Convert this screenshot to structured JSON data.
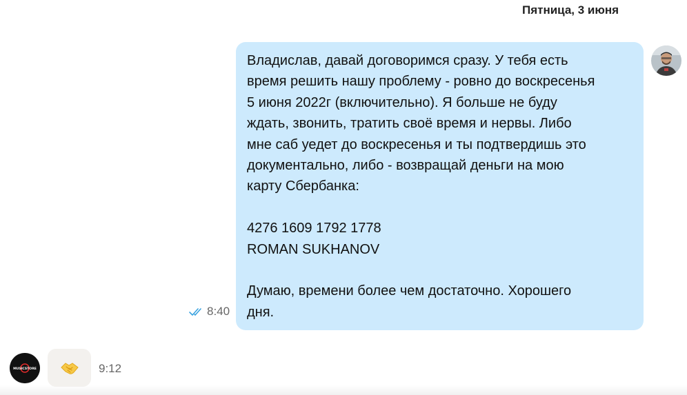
{
  "date_header": "Пятница, 3 июня",
  "messages": [
    {
      "direction": "outgoing",
      "text": "Владислав, давай договоримся сразу. У тебя есть\nвремя решить нашу проблему - ровно до воскресенья\n5 июня 2022г (включительно). Я больше не буду\nждать, звонить, тратить своё время и нервы. Либо\nмне саб уедет до воскресенья и ты подтвердишь это\nдокументально, либо - возвращай деньги на мою\nкарту Сбербанка:\n\n4276 1609 1792 1778\nROMAN SUKHANOV\n\nДумаю, времени более чем достаточно. Хорошего\nдня.",
      "time": "8:40",
      "status_icon": "double-check-icon",
      "status_color": "#3aa3e0"
    },
    {
      "direction": "incoming",
      "sticker": "handshake-icon",
      "time": "9:12",
      "avatar_logo_text": "MUSICSTORE"
    }
  ],
  "colors": {
    "outgoing_bubble": "#cdeafd",
    "incoming_bubble": "#f3f1ee",
    "logo_accent": "#e52b2b"
  }
}
